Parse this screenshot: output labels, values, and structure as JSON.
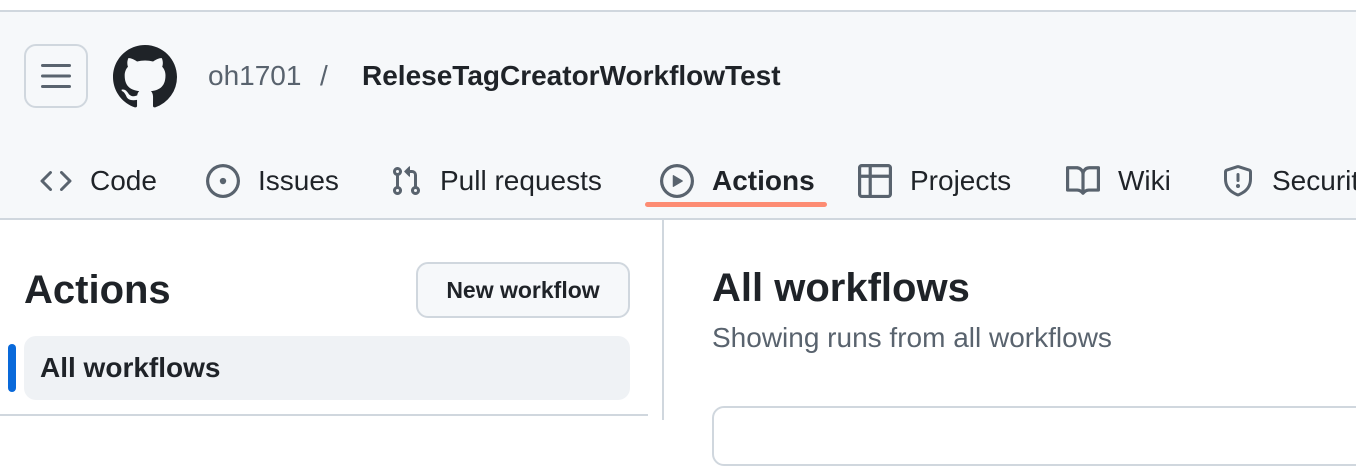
{
  "breadcrumb": {
    "owner": "oh1701",
    "separator": "/",
    "repo": "ReleseTagCreatorWorkflowTest"
  },
  "tabs": [
    {
      "label": "Code",
      "icon": "code-icon"
    },
    {
      "label": "Issues",
      "icon": "issue-opened-icon"
    },
    {
      "label": "Pull requests",
      "icon": "git-pull-request-icon"
    },
    {
      "label": "Actions",
      "icon": "play-icon",
      "active": true
    },
    {
      "label": "Projects",
      "icon": "table-icon"
    },
    {
      "label": "Wiki",
      "icon": "book-icon"
    },
    {
      "label": "Securit",
      "icon": "shield-icon"
    }
  ],
  "sidebar": {
    "title": "Actions",
    "new_workflow_label": "New workflow",
    "items": [
      {
        "label": "All workflows",
        "selected": true
      }
    ]
  },
  "main": {
    "title": "All workflows",
    "subtitle": "Showing runs from all workflows"
  },
  "colors": {
    "accent": "#0969da",
    "tab_underline": "#fd8c73",
    "header_bg": "#f6f8fa",
    "border": "#d0d7de"
  }
}
